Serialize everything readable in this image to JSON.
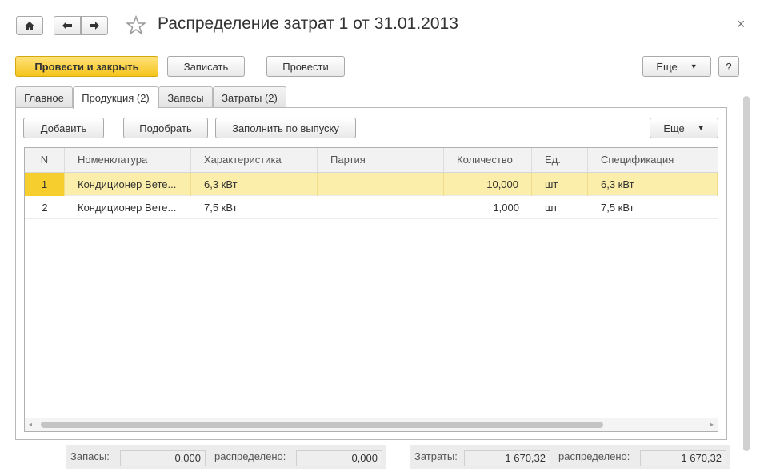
{
  "window": {
    "title": "Распределение затрат 1 от 31.01.2013",
    "close_symbol": "×"
  },
  "toolbar": {
    "post_close": "Провести и закрыть",
    "save": "Записать",
    "post": "Провести",
    "more": "Еще",
    "help": "?"
  },
  "tabs": [
    {
      "label": "Главное"
    },
    {
      "label": "Продукция (2)"
    },
    {
      "label": "Запасы"
    },
    {
      "label": "Затраты (2)"
    }
  ],
  "tab_toolbar": {
    "add": "Добавить",
    "pick": "Подобрать",
    "fill": "Заполнить по выпуску",
    "more": "Еще"
  },
  "table": {
    "columns": [
      "N",
      "Номенклатура",
      "Характеристика",
      "Партия",
      "Количество",
      "Ед.",
      "Спецификация"
    ],
    "rows": [
      {
        "n": "1",
        "item": "Кондиционер Вете...",
        "char": "6,3 кВт",
        "batch": "",
        "qty": "10,000",
        "unit": "шт",
        "spec": "6,3 кВт"
      },
      {
        "n": "2",
        "item": "Кондиционер Вете...",
        "char": "7,5 кВт",
        "batch": "",
        "qty": "1,000",
        "unit": "шт",
        "spec": "7,5 кВт"
      }
    ]
  },
  "footer": {
    "stock_label": "Запасы:",
    "stock_value": "0,000",
    "stock_dist_label": "распределено:",
    "stock_dist_value": "0,000",
    "costs_label": "Затраты:",
    "costs_value": "1 670,32",
    "costs_dist_label": "распределено:",
    "costs_dist_value": "1 670,32"
  },
  "colors": {
    "accent": "#f5c41c",
    "selected_row": "#fbeeaa"
  }
}
